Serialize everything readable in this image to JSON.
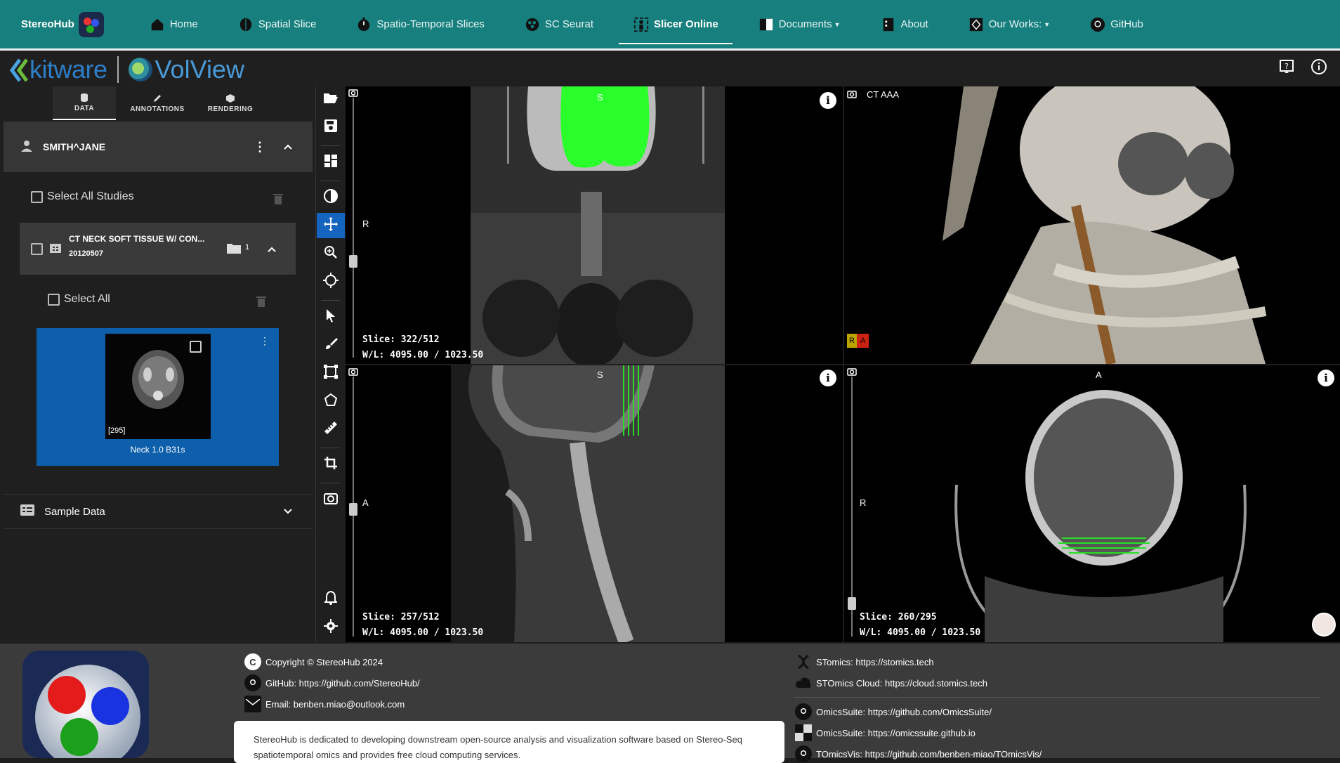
{
  "nav": {
    "brand": "StereoHub",
    "items": [
      {
        "label": "Home",
        "icon": "home-icon"
      },
      {
        "label": "Spatial Slice",
        "icon": "brain-icon"
      },
      {
        "label": "Spatio-Temporal Slices",
        "icon": "timer-icon"
      },
      {
        "label": "SC Seurat",
        "icon": "cells-icon"
      },
      {
        "label": "Slicer Online",
        "icon": "slicer-icon"
      },
      {
        "label": "Documents",
        "icon": "document-icon"
      },
      {
        "label": "About",
        "icon": "building-icon"
      },
      {
        "label": "Our Works:",
        "icon": "works-icon"
      },
      {
        "label": "GitHub",
        "icon": "github-icon"
      }
    ]
  },
  "volview": {
    "kitware": "kitware",
    "volview": "VolView"
  },
  "tabs": [
    {
      "label": "DATA"
    },
    {
      "label": "ANNOTATIONS"
    },
    {
      "label": "RENDERING"
    }
  ],
  "patient": {
    "name": "SMITH^JANE"
  },
  "studies": {
    "select_all": "Select All Studies",
    "study_title": "CT NECK SOFT TISSUE W/ CON...",
    "study_date": "20120507",
    "series_count": "1",
    "series_select_all": "Select All",
    "series_count_label": "[295]",
    "series_name": "Neck 1.0 B31s"
  },
  "sample_data": {
    "label": "Sample Data"
  },
  "viewports": {
    "coronal": {
      "top": "S",
      "left": "R",
      "slice": "Slice: 322/512",
      "wl": "W/L: 4095.00 / 1023.50"
    },
    "render3d": {
      "title": "CT AAA",
      "orient_r": "R",
      "orient_a": "A"
    },
    "sagittal": {
      "top": "S",
      "left": "A",
      "slice": "Slice: 257/512",
      "wl": "W/L: 4095.00 / 1023.50"
    },
    "axial": {
      "top": "A",
      "left": "R",
      "slice": "Slice: 260/295",
      "wl": "W/L: 4095.00 / 1023.50"
    }
  },
  "footer": {
    "copyright": "Copyright © StereoHub 2024",
    "github": "GitHub: https://github.com/StereoHub/",
    "email": "Email: benben.miao@outlook.com",
    "stomics": "STomics: https://stomics.tech",
    "stomics_cloud": "STOmics Cloud: https://cloud.stomics.tech",
    "omics_github": "OmicsSuite: https://github.com/OmicsSuite/",
    "omics_io": "OmicsSuite: https://omicssuite.github.io",
    "tomics": "TOmicsVis: https://github.com/benben-miao/TOmicsVis/",
    "description": "StereoHub is dedicated to developing downstream open-source analysis and visualization software based on Stereo-Seq spatiotemporal omics and provides free cloud computing services."
  }
}
